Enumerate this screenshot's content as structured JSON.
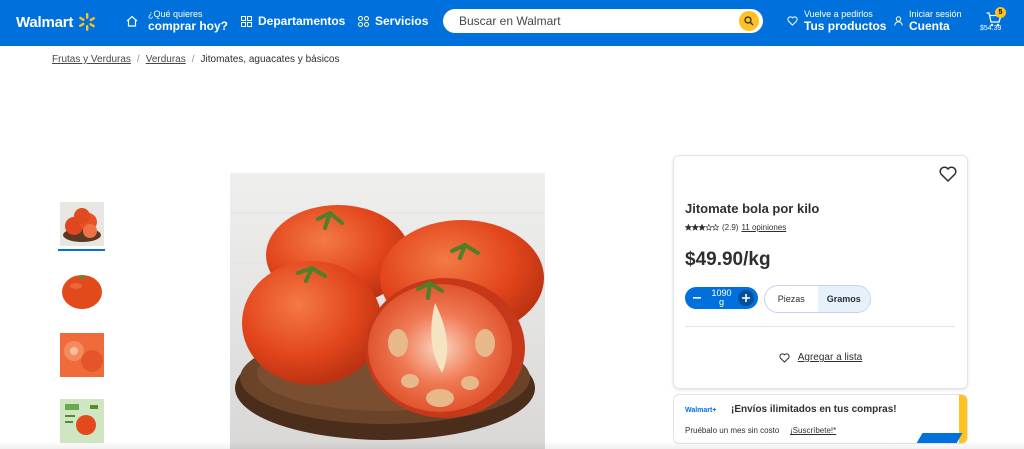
{
  "header": {
    "logo_text": "Walmart",
    "what_want_small": "¿Qué quieres",
    "what_want_big": "comprar hoy?",
    "departments": "Departamentos",
    "services": "Servicios",
    "search_placeholder": "Buscar en Walmart",
    "reorder_small": "Vuelve a pedirlos",
    "reorder_big": "Tus productos",
    "account_small": "Iniciar sesión",
    "account_big": "Cuenta",
    "cart_count": "5",
    "cart_total": "$54.39"
  },
  "breadcrumb": {
    "items": [
      "Frutas y Verduras",
      "Verduras"
    ],
    "current": "Jitomates, aguacates y básicos",
    "separator": "/"
  },
  "product": {
    "title": "Jitomate bola por kilo",
    "rating_value": "(2.9)",
    "rating_stars": 2.9,
    "reviews": "11 opiniones",
    "price": "$49.90/kg",
    "quantity_value": "1090",
    "quantity_unit": "g",
    "unit_options": [
      "Piezas",
      "Gramos"
    ],
    "selected_unit": "Gramos",
    "add_to_list": "Agregar a lista"
  },
  "promo": {
    "logo": "Walmart+",
    "title": "¡Envíos ilimitados en tus compras!",
    "subtitle": "Pruébalo un mes sin costo",
    "link": "¡Suscríbete!*"
  },
  "colors": {
    "brand_blue": "#0071dc",
    "spark_yellow": "#ffc220"
  }
}
